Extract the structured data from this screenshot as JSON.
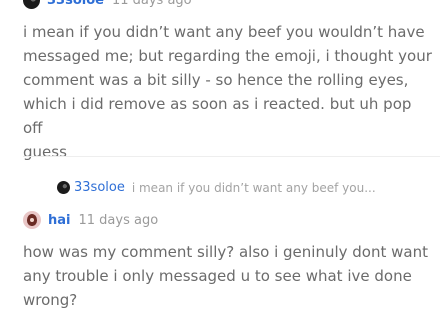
{
  "comment_prev": {
    "username": "33soloe",
    "timestamp": "11 days ago",
    "lines": [
      "i mean if you didn’t want any beef you wouldn’t have",
      "messaged me; but regarding the emoji, i thought your",
      "comment was a bit silly - so hence the rolling eyes,",
      "which i did remove as soon as i reacted. but uh pop off",
      "guess"
    ]
  },
  "reply_ref": {
    "username": "33soloe",
    "snippet": "i mean if you didn’t want any beef you..."
  },
  "comment_reply": {
    "username": "hai",
    "timestamp": "11 days ago",
    "lines": [
      "how was my comment silly? also i geninuly dont want",
      "any trouble i only messaged u to see what ive done",
      "wrong?"
    ]
  }
}
